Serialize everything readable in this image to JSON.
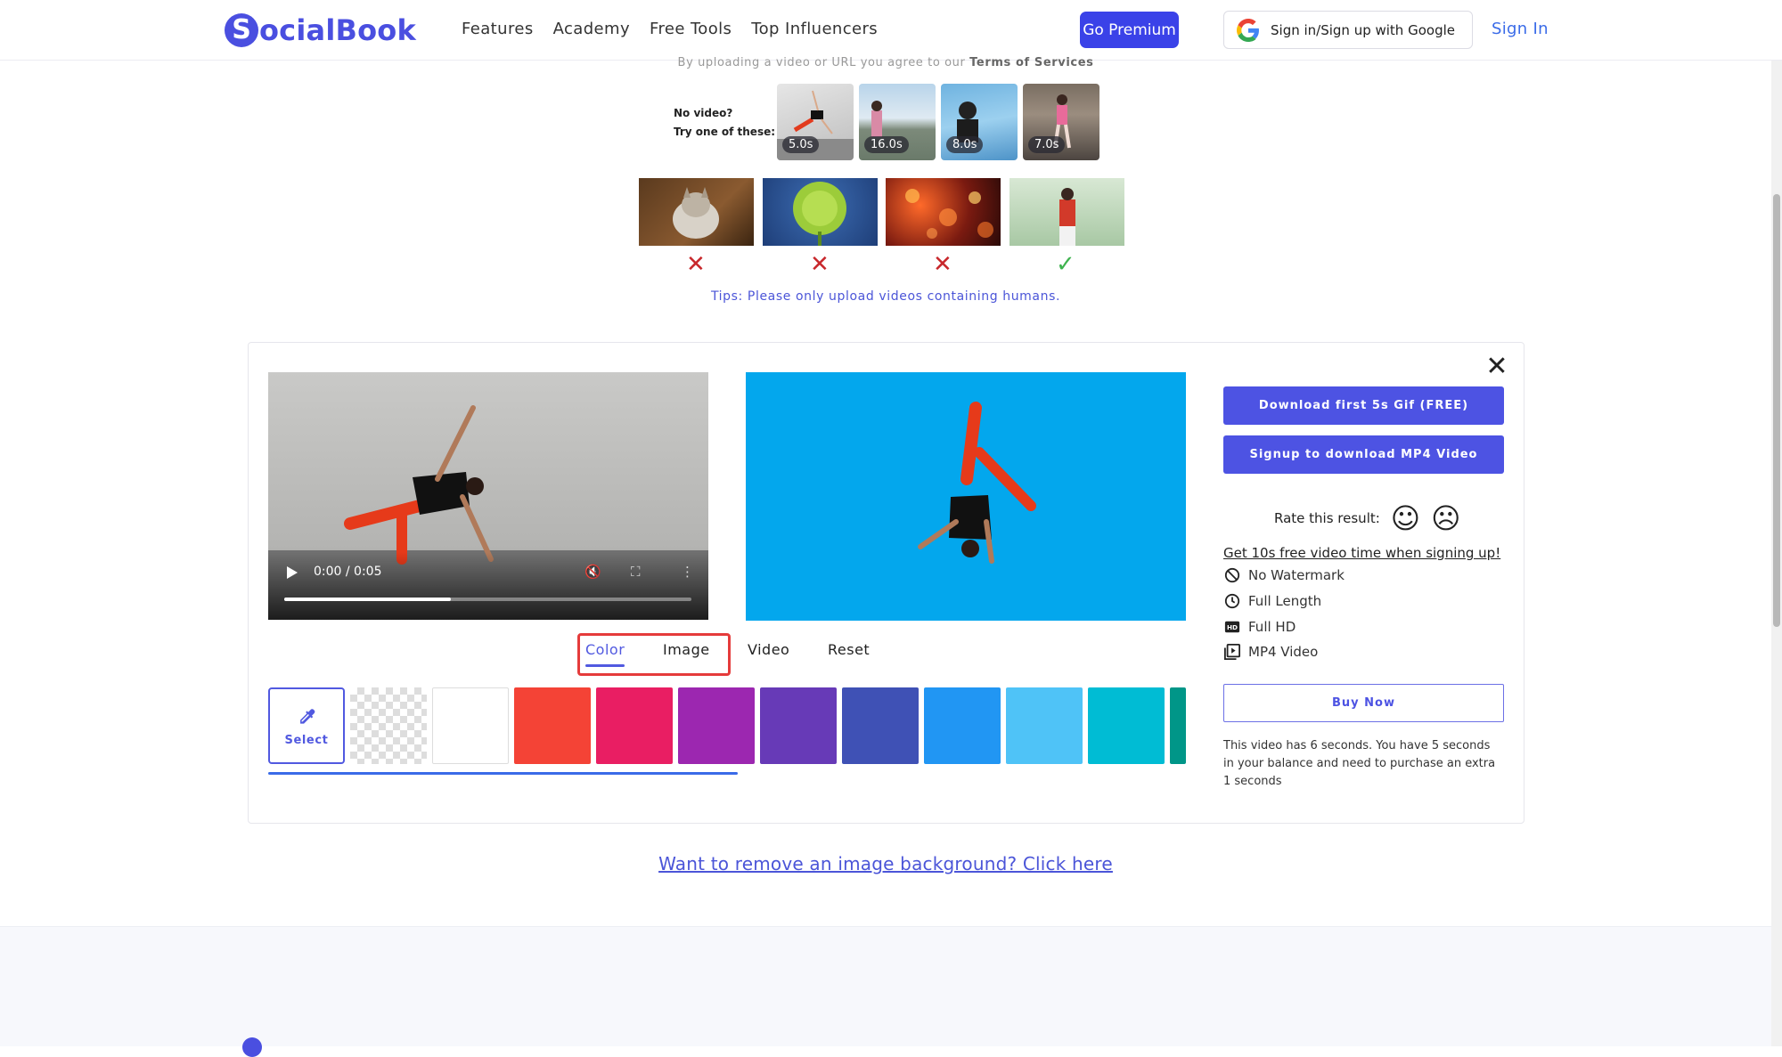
{
  "header": {
    "logo_letter": "S",
    "logo_text": "ocialBook",
    "nav": [
      {
        "label": "Features"
      },
      {
        "label": "Academy"
      },
      {
        "label": "Free Tools"
      },
      {
        "label": "Top Influencers"
      }
    ],
    "premium_label": "Go Premium",
    "google_label": "Sign in/Sign up with Google",
    "signin_label": "Sign In"
  },
  "upload": {
    "terms_prefix": "By uploading a video or URL you agree to our ",
    "terms_link": "Terms of Services",
    "novideo_line1": "No video?",
    "novideo_line2": "Try one of these:",
    "samples": [
      {
        "duration": "5.0s"
      },
      {
        "duration": "16.0s"
      },
      {
        "duration": "8.0s"
      },
      {
        "duration": "7.0s"
      }
    ],
    "examples": [
      {
        "subject": "cat",
        "ok": false
      },
      {
        "subject": "flower",
        "ok": false
      },
      {
        "subject": "bokeh lights",
        "ok": false
      },
      {
        "subject": "person",
        "ok": true
      }
    ],
    "tips": "Tips: Please only upload videos containing humans."
  },
  "editor": {
    "player": {
      "time": "0:00 / 0:05",
      "progress": 0.41
    },
    "result_bg": "#03a7ed",
    "tabs": [
      {
        "label": "Color",
        "active": true
      },
      {
        "label": "Image",
        "active": false
      },
      {
        "label": "Video",
        "active": false
      },
      {
        "label": "Reset",
        "active": false
      }
    ],
    "select_label": "Select",
    "swatches": [
      "transparent",
      "#ffffff",
      "#f44336",
      "#e91e63",
      "#9c27b0",
      "#673ab7",
      "#3f51b5",
      "#2196f3",
      "#4fc3f7",
      "#00bcd4",
      "#009688"
    ]
  },
  "panel": {
    "download_gif": "Download first 5s Gif (FREE)",
    "signup_mp4": "Signup to download MP4 Video",
    "rate_label": "Rate this result:",
    "free_link": "Get 10s free video time when signing up!",
    "features": [
      {
        "icon": "no-watermark-icon",
        "label": "No Watermark"
      },
      {
        "icon": "clock-icon",
        "label": "Full Length"
      },
      {
        "icon": "hd-icon",
        "label": "Full HD"
      },
      {
        "icon": "video-file-icon",
        "label": "MP4 Video"
      }
    ],
    "buy_label": "Buy Now",
    "note": "This video has 6 seconds. You have 5 seconds in your balance and need to purchase an extra 1 seconds"
  },
  "image_link": "Want to remove an image background? Click here"
}
